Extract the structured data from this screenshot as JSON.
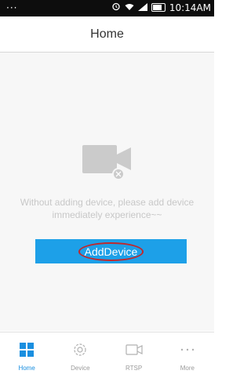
{
  "status_bar": {
    "left_glyphs": "··· ",
    "time": "10:14AM"
  },
  "header": {
    "title": "Home"
  },
  "empty_state": {
    "icon": "video-camera-off-icon",
    "message": "Without adding device, please add device immediately experience~~"
  },
  "add_button": {
    "label": "AddDevice"
  },
  "tabs": [
    {
      "label": "Home",
      "icon": "home-grid-icon",
      "active": true
    },
    {
      "label": "Device",
      "icon": "gear-icon",
      "active": false
    },
    {
      "label": "RTSP",
      "icon": "video-camera-icon",
      "active": false
    },
    {
      "label": "More",
      "icon": "more-dots-icon",
      "active": false
    }
  ],
  "colors": {
    "accent": "#1da0e8",
    "tab_active": "#1a8fe0",
    "highlight_circle": "#c0282d"
  }
}
